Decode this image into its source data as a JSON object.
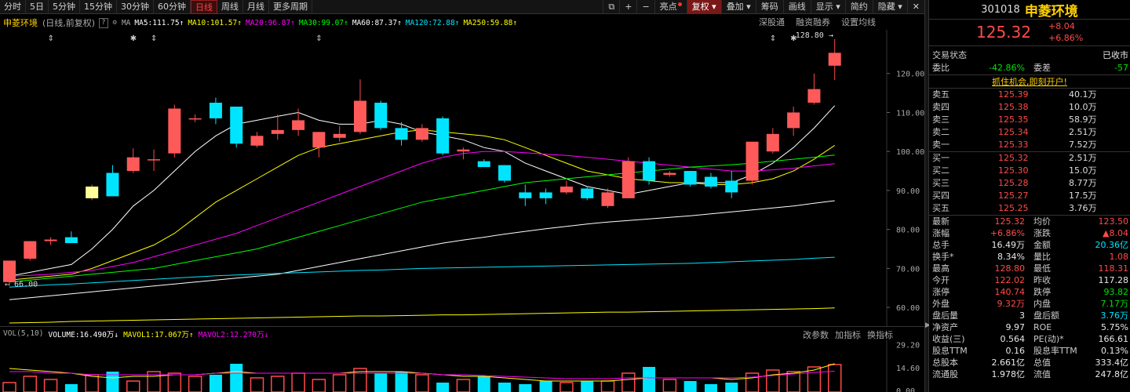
{
  "toolbar": {
    "timeframes": [
      "分时",
      "5日",
      "5分钟",
      "15分钟",
      "30分钟",
      "60分钟",
      "日线",
      "周线",
      "月线",
      "更多周期"
    ],
    "active_index": 6,
    "right_buttons": [
      {
        "name": "layout-icon",
        "label": "⧉"
      },
      {
        "name": "zoom-in-button",
        "label": "+"
      },
      {
        "name": "zoom-out-button",
        "label": "−"
      },
      {
        "name": "highlight-button",
        "label": "亮点"
      },
      {
        "name": "adjust-button",
        "label": "复权"
      },
      {
        "name": "overlay-button",
        "label": "叠加"
      },
      {
        "name": "chips-button",
        "label": "筹码"
      },
      {
        "name": "draw-button",
        "label": "画线"
      },
      {
        "name": "display-button",
        "label": "显示"
      },
      {
        "name": "simple-button",
        "label": "简约"
      },
      {
        "name": "hide-button",
        "label": "隐藏"
      },
      {
        "name": "close-button",
        "label": "✕"
      }
    ]
  },
  "info": {
    "stock_name": "申菱环境",
    "mode": "(日线,前复权)",
    "help": "?",
    "ma_label": "MA",
    "ma": [
      {
        "label": "MA5:111.75",
        "color": "#ffffff",
        "arrow": "↑"
      },
      {
        "label": "MA10:101.57",
        "color": "#ffff00",
        "arrow": "↑"
      },
      {
        "label": "MA20:96.87",
        "color": "#ff00ff",
        "arrow": "↑"
      },
      {
        "label": "MA30:99.07",
        "color": "#00ff00",
        "arrow": "↑"
      },
      {
        "label": "MA60:87.37",
        "color": "#ffffff",
        "arrow": "↑"
      },
      {
        "label": "MA120:72.88",
        "color": "#00e5ff",
        "arrow": "↑"
      },
      {
        "label": "MA250:59.88",
        "color": "#ffff00",
        "arrow": "↑"
      }
    ],
    "right": [
      "深股通",
      "融资融券",
      "设置均线"
    ]
  },
  "chart_data": {
    "type": "candlestick",
    "y_ticks": [
      60,
      70,
      80,
      90,
      100,
      110,
      120
    ],
    "ylim": [
      56,
      130
    ],
    "high_label": "128.80",
    "low_label": "66.00",
    "candles": [
      {
        "o": 66.5,
        "h": 69.5,
        "l": 65.5,
        "c": 72.0
      },
      {
        "o": 72.5,
        "h": 77.0,
        "l": 72.0,
        "c": 77.0
      },
      {
        "o": 77.0,
        "h": 78.0,
        "l": 76.0,
        "c": 77.4
      },
      {
        "o": 78.0,
        "h": 79.5,
        "l": 76.5,
        "c": 76.5
      },
      {
        "o": 88.0,
        "h": 91.5,
        "l": 87.5,
        "c": 91.0
      },
      {
        "o": 94.5,
        "h": 96.5,
        "l": 94.0,
        "c": 88.5
      },
      {
        "o": 95.0,
        "h": 100.8,
        "l": 94.5,
        "c": 98.5
      },
      {
        "o": 98.0,
        "h": 100.5,
        "l": 95.0,
        "c": 98.0
      },
      {
        "o": 99.5,
        "h": 112.0,
        "l": 98.5,
        "c": 111.0
      },
      {
        "o": 108.5,
        "h": 109.5,
        "l": 107.5,
        "c": 108.5
      },
      {
        "o": 112.5,
        "h": 113.8,
        "l": 107.0,
        "c": 108.5
      },
      {
        "o": 111.5,
        "h": 111.5,
        "l": 101.0,
        "c": 102.0
      },
      {
        "o": 101.5,
        "h": 105.0,
        "l": 101.0,
        "c": 104.0
      },
      {
        "o": 104.5,
        "h": 109.5,
        "l": 103.0,
        "c": 105.5
      },
      {
        "o": 105.5,
        "h": 111.0,
        "l": 104.0,
        "c": 108.0
      },
      {
        "o": 101.0,
        "h": 105.0,
        "l": 98.5,
        "c": 105.0
      },
      {
        "o": 103.5,
        "h": 106.5,
        "l": 102.5,
        "c": 104.5
      },
      {
        "o": 105.0,
        "h": 118.5,
        "l": 104.5,
        "c": 113.0
      },
      {
        "o": 112.5,
        "h": 113.0,
        "l": 105.5,
        "c": 106.0
      },
      {
        "o": 106.0,
        "h": 107.5,
        "l": 101.5,
        "c": 103.0
      },
      {
        "o": 103.0,
        "h": 107.0,
        "l": 102.5,
        "c": 106.0
      },
      {
        "o": 108.5,
        "h": 109.0,
        "l": 99.0,
        "c": 99.5
      },
      {
        "o": 100.0,
        "h": 101.0,
        "l": 98.0,
        "c": 100.5
      },
      {
        "o": 97.5,
        "h": 98.0,
        "l": 96.0,
        "c": 96.0
      },
      {
        "o": 96.5,
        "h": 96.5,
        "l": 92.0,
        "c": 92.5
      },
      {
        "o": 89.5,
        "h": 91.5,
        "l": 86.0,
        "c": 88.0
      },
      {
        "o": 89.5,
        "h": 90.5,
        "l": 86.5,
        "c": 88.0
      },
      {
        "o": 89.5,
        "h": 92.5,
        "l": 89.0,
        "c": 91.0
      },
      {
        "o": 90.5,
        "h": 91.0,
        "l": 87.5,
        "c": 88.0
      },
      {
        "o": 86.0,
        "h": 90.5,
        "l": 85.5,
        "c": 89.5
      },
      {
        "o": 88.0,
        "h": 98.5,
        "l": 88.0,
        "c": 97.5
      },
      {
        "o": 97.5,
        "h": 98.5,
        "l": 91.5,
        "c": 92.5
      },
      {
        "o": 94.0,
        "h": 95.0,
        "l": 93.5,
        "c": 94.5
      },
      {
        "o": 95.0,
        "h": 95.0,
        "l": 91.0,
        "c": 91.5
      },
      {
        "o": 93.5,
        "h": 94.5,
        "l": 90.5,
        "c": 91.0
      },
      {
        "o": 92.5,
        "h": 95.0,
        "l": 88.0,
        "c": 89.5
      },
      {
        "o": 92.5,
        "h": 102.5,
        "l": 91.5,
        "c": 102.5
      },
      {
        "o": 100.0,
        "h": 106.0,
        "l": 99.5,
        "c": 104.5
      },
      {
        "o": 106.0,
        "h": 111.5,
        "l": 104.0,
        "c": 110.0
      },
      {
        "o": 112.5,
        "h": 120.0,
        "l": 112.0,
        "c": 116.0
      },
      {
        "o": 122.0,
        "h": 128.8,
        "l": 118.3,
        "c": 125.3
      }
    ],
    "ma_lines": [
      {
        "name": "MA5",
        "color": "#ffffff",
        "values": [
          68,
          69,
          70,
          71,
          75,
          80,
          86,
          90,
          95,
          100,
          104,
          107,
          108,
          109,
          110,
          108,
          107,
          107,
          108,
          107,
          105,
          104,
          103,
          101,
          100,
          97,
          95,
          93,
          91,
          90,
          89,
          90,
          91,
          92,
          92,
          92,
          94,
          97,
          101,
          106,
          111.75
        ]
      },
      {
        "name": "MA10",
        "color": "#ffff00",
        "values": [
          67,
          67.5,
          68,
          68.5,
          70,
          72,
          74,
          76,
          79,
          83,
          87,
          90,
          93,
          96,
          99,
          101,
          102,
          103,
          104,
          105,
          105.5,
          105,
          104.5,
          104,
          103,
          101,
          99,
          97,
          95,
          94,
          93,
          92.5,
          92,
          92,
          91.5,
          91.5,
          92,
          93,
          95,
          98,
          101.57
        ]
      },
      {
        "name": "MA20",
        "color": "#ff00ff",
        "values": [
          68,
          68.2,
          68.5,
          69,
          69.5,
          70.5,
          71.5,
          73,
          74.5,
          76,
          77.5,
          79,
          81,
          83,
          85,
          87,
          89,
          91,
          93,
          95,
          97,
          98.5,
          99.5,
          100,
          100,
          99.7,
          99.3,
          99,
          98.5,
          98,
          97.5,
          97,
          96.5,
          96,
          95.5,
          95,
          95,
          95.3,
          95.7,
          96.3,
          96.87
        ]
      },
      {
        "name": "MA30",
        "color": "#00ff00",
        "values": [
          66.5,
          67,
          67.5,
          68,
          68.5,
          69,
          69.5,
          70,
          71,
          72,
          73,
          74,
          75,
          76.5,
          78,
          79.5,
          81,
          82.5,
          84,
          85.5,
          87,
          88,
          89,
          90,
          91,
          92,
          92.5,
          93,
          93.5,
          94,
          94.5,
          95,
          95.5,
          96,
          96.3,
          96.6,
          97,
          97.5,
          98,
          98.5,
          99.07
        ]
      },
      {
        "name": "MA60",
        "color": "#ffffff",
        "values": [
          62,
          62.5,
          63,
          63.5,
          64,
          64.5,
          65,
          65.5,
          66,
          66.5,
          67,
          67.5,
          68,
          68.5,
          69.5,
          70.5,
          71.5,
          72.5,
          73.5,
          74.5,
          75.5,
          76.5,
          77.3,
          78,
          78.8,
          79.5,
          80.2,
          80.8,
          81.4,
          81.9,
          82.3,
          82.7,
          83.1,
          83.5,
          84,
          84.5,
          85,
          85.5,
          86,
          86.7,
          87.37
        ]
      },
      {
        "name": "MA120",
        "color": "#00e5ff",
        "values": [
          65.2,
          65.5,
          65.8,
          66,
          66.3,
          66.6,
          66.9,
          67.2,
          67.5,
          67.8,
          68.1,
          68.3,
          68.5,
          68.7,
          68.9,
          69.1,
          69.3,
          69.5,
          69.6,
          69.8,
          70,
          70.1,
          70.2,
          70.3,
          70.4,
          70.5,
          70.6,
          70.7,
          70.8,
          70.9,
          71,
          71.1,
          71.2,
          71.3,
          71.5,
          71.7,
          71.9,
          72.1,
          72.3,
          72.6,
          72.88
        ]
      },
      {
        "name": "MA250",
        "color": "#ffff00",
        "values": [
          56,
          56.1,
          56.2,
          56.4,
          56.5,
          56.6,
          56.7,
          56.8,
          56.9,
          57,
          57.1,
          57.2,
          57.3,
          57.4,
          57.5,
          57.6,
          57.7,
          57.8,
          57.8,
          57.9,
          58,
          58.1,
          58.1,
          58.2,
          58.3,
          58.4,
          58.5,
          58.6,
          58.7,
          58.8,
          58.8,
          58.9,
          59,
          59.1,
          59.2,
          59.3,
          59.4,
          59.5,
          59.6,
          59.7,
          59.88
        ]
      }
    ],
    "volume": {
      "y_ticks": [
        "29.20",
        "14.60",
        "0.00"
      ],
      "ymax": 30,
      "bars": [
        5,
        9,
        7,
        4,
        10,
        12,
        6,
        12,
        11,
        9,
        10,
        17,
        8,
        9,
        11,
        7,
        10,
        14,
        11,
        12,
        10,
        5,
        7,
        9,
        5,
        4,
        6,
        5,
        6,
        6,
        11,
        15,
        7,
        6,
        4,
        5,
        11,
        13,
        12,
        15,
        16.49
      ],
      "mavol1": [
        14,
        13,
        12,
        11,
        9,
        8,
        9,
        9,
        10,
        10,
        11,
        12,
        11,
        11,
        11,
        11,
        11,
        12,
        12,
        12,
        11,
        10,
        9,
        9,
        8,
        7,
        6,
        6,
        6,
        6,
        7,
        8,
        8,
        8,
        8,
        7,
        8,
        10,
        11,
        13,
        17.067
      ],
      "mavol2": [
        12,
        12,
        11,
        11,
        10,
        10,
        10,
        10,
        10,
        10,
        11,
        11,
        11,
        11,
        11,
        11,
        11,
        11,
        11,
        11,
        11,
        10,
        10,
        9.5,
        9,
        8.5,
        8,
        7.5,
        7.5,
        7.5,
        8,
        8,
        8,
        8,
        8,
        8,
        8.5,
        9.5,
        10.5,
        11.5,
        12.27
      ]
    }
  },
  "volume_info": {
    "name": "VOL(5,10)",
    "items": [
      {
        "label": "VOLUME:16.490万",
        "color": "#ffffff",
        "arrow": "↓"
      },
      {
        "label": "MAVOL1:17.067万",
        "color": "#ffff00",
        "arrow": "↑"
      },
      {
        "label": "MAVOL2:12.270万",
        "color": "#ff00ff",
        "arrow": "↓"
      }
    ],
    "right": [
      "改参数",
      "加指标",
      "换指标"
    ]
  },
  "quote": {
    "code": "301018",
    "name": "申菱环境",
    "price": "125.32",
    "change": "+8.04",
    "change_pct": "+6.86%",
    "trade_status_label": "交易状态",
    "trade_status": "已收市",
    "wb_label": "委比",
    "wb": "-42.86%",
    "wc_label": "委差",
    "wc": "-57",
    "promo": "抓住机会,即刻开户!",
    "asks": [
      {
        "label": "卖五",
        "price": "125.39",
        "vol": "40.1万"
      },
      {
        "label": "卖四",
        "price": "125.38",
        "vol": "10.0万"
      },
      {
        "label": "卖三",
        "price": "125.35",
        "vol": "58.9万"
      },
      {
        "label": "卖二",
        "price": "125.34",
        "vol": "2.51万"
      },
      {
        "label": "卖一",
        "price": "125.33",
        "vol": "7.52万"
      }
    ],
    "bids": [
      {
        "label": "买一",
        "price": "125.32",
        "vol": "2.51万"
      },
      {
        "label": "买二",
        "price": "125.30",
        "vol": "15.0万"
      },
      {
        "label": "买三",
        "price": "125.28",
        "vol": "8.77万"
      },
      {
        "label": "买四",
        "price": "125.27",
        "vol": "17.5万"
      },
      {
        "label": "买五",
        "price": "125.25",
        "vol": "3.76万"
      }
    ],
    "stats": [
      {
        "l1": "最新",
        "v1": "125.32",
        "c1": "red",
        "l2": "均价",
        "v2": "123.50",
        "c2": "red"
      },
      {
        "l1": "涨幅",
        "v1": "+6.86%",
        "c1": "red",
        "l2": "涨跌",
        "v2": "▲8.04",
        "c2": "red"
      },
      {
        "l1": "总手",
        "v1": "16.49万",
        "c1": "wht",
        "l2": "金额",
        "v2": "20.36亿",
        "c2": "cyn"
      },
      {
        "l1": "换手*",
        "v1": "8.34%",
        "c1": "wht",
        "l2": "量比",
        "v2": "1.08",
        "c2": "red"
      },
      {
        "l1": "最高",
        "v1": "128.80",
        "c1": "red",
        "l2": "最低",
        "v2": "118.31",
        "c2": "red"
      },
      {
        "l1": "今开",
        "v1": "122.02",
        "c1": "red",
        "l2": "昨收",
        "v2": "117.28",
        "c2": "wht"
      },
      {
        "l1": "涨停",
        "v1": "140.74",
        "c1": "red",
        "l2": "跌停",
        "v2": "93.82",
        "c2": "grn"
      },
      {
        "l1": "外盘",
        "v1": "9.32万",
        "c1": "red",
        "l2": "内盘",
        "v2": "7.17万",
        "c2": "grn"
      },
      {
        "l1": "盘后量",
        "v1": "3",
        "c1": "wht",
        "l2": "盘后额",
        "v2": "3.76万",
        "c2": "cyn"
      },
      {
        "l1": "净资产",
        "v1": "9.97",
        "c1": "wht",
        "l2": "ROE",
        "v2": "5.75%",
        "c2": "wht"
      },
      {
        "l1": "收益(三)",
        "v1": "0.564",
        "c1": "wht",
        "l2": "PE(动)*",
        "v2": "166.61",
        "c2": "wht"
      },
      {
        "l1": "股息TTM",
        "v1": "0.16",
        "c1": "wht",
        "l2": "股息率TTM",
        "v2": "0.13%",
        "c2": "wht"
      },
      {
        "l1": "总股本",
        "v1": "2.661亿",
        "c1": "wht",
        "l2": "总值",
        "v2": "333.4亿",
        "c2": "wht"
      },
      {
        "l1": "流通股",
        "v1": "1.978亿",
        "c1": "wht",
        "l2": "流值",
        "v2": "247.8亿",
        "c2": "wht"
      }
    ]
  }
}
